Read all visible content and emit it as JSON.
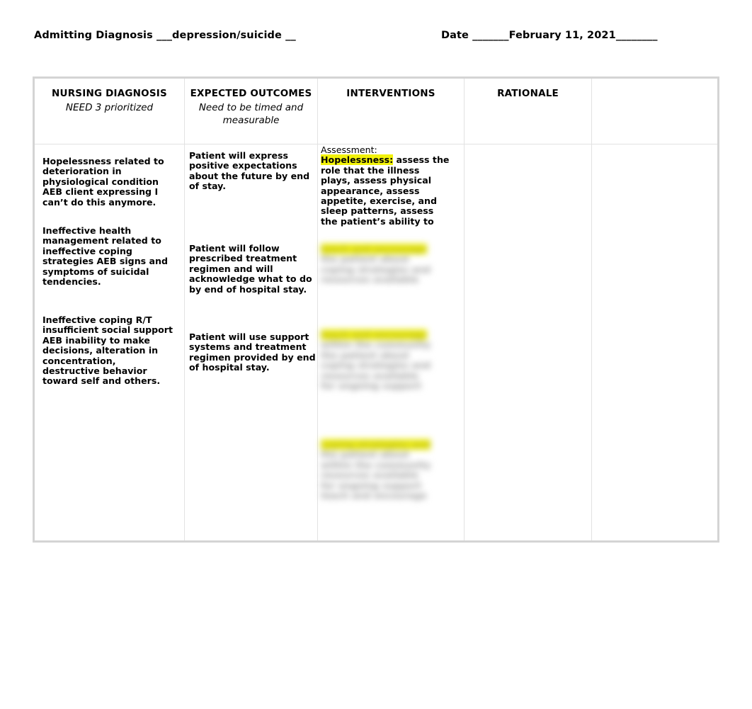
{
  "header": {
    "admitting_diagnosis_label": "Admitting Diagnosis ___",
    "admitting_diagnosis_value": "depression/suicide __",
    "admitting_diagnosis_full": "Admitting Diagnosis ___depression/suicide __",
    "date_label": "Date _______",
    "date_value": "February 11, 2021",
    "date_trailing": "________",
    "date_full": "Date _______February 11, 2021________"
  },
  "table": {
    "columns": [
      {
        "title": "NURSING DIAGNOSIS",
        "subtitle": "NEED 3 prioritized"
      },
      {
        "title": "EXPECTED OUTCOMES",
        "subtitle": "Need to be timed and measurable"
      },
      {
        "title": "INTERVENTIONS",
        "subtitle": ""
      },
      {
        "title": "RATIONALE",
        "subtitle": ""
      },
      {
        "title": "",
        "subtitle": ""
      }
    ],
    "nursing_diagnosis": [
      "Hopelessness related to deterioration in physiological condition AEB client expressing I can’t do this anymore.",
      "Ineffective health management related to ineffective coping strategies AEB signs and symptoms of suicidal tendencies.",
      "Ineffective coping R/T insufficient social support AEB inability to make decisions, alteration in concentration, destructive behavior toward self and others."
    ],
    "expected_outcomes": [
      "Patient will express positive expectations about the future by end of stay.",
      "Patient will follow prescribed treatment regimen and will acknowledge what to do by end of hospital stay.",
      "Patient will use support systems and treatment regimen provided by end of hospital stay."
    ],
    "interventions": {
      "assessment_label": "Assessment:",
      "highlighted_term": "Hopelessness:",
      "visible_text": " assess the role that the illness plays, assess physical appearance, assess appetite, exercise, and sleep patterns, assess the patient’s ability to",
      "redacted_note": "remaining intervention text is blurred and unreadable"
    },
    "rationale": [
      "",
      "",
      ""
    ],
    "extra_column": [
      "",
      "",
      ""
    ]
  },
  "colors": {
    "highlight": "#f2f20a",
    "table_border": "#d4d4d4",
    "cell_divider": "#e2e2e2",
    "text": "#000000",
    "page_background": "#ffffff"
  },
  "blurred_filler": {
    "line_a": "teach and encourage",
    "line_b": "the patient about",
    "line_c": "coping strategies and",
    "line_d": "resources available",
    "line_e": "within the community",
    "line_f": "for ongoing support"
  }
}
